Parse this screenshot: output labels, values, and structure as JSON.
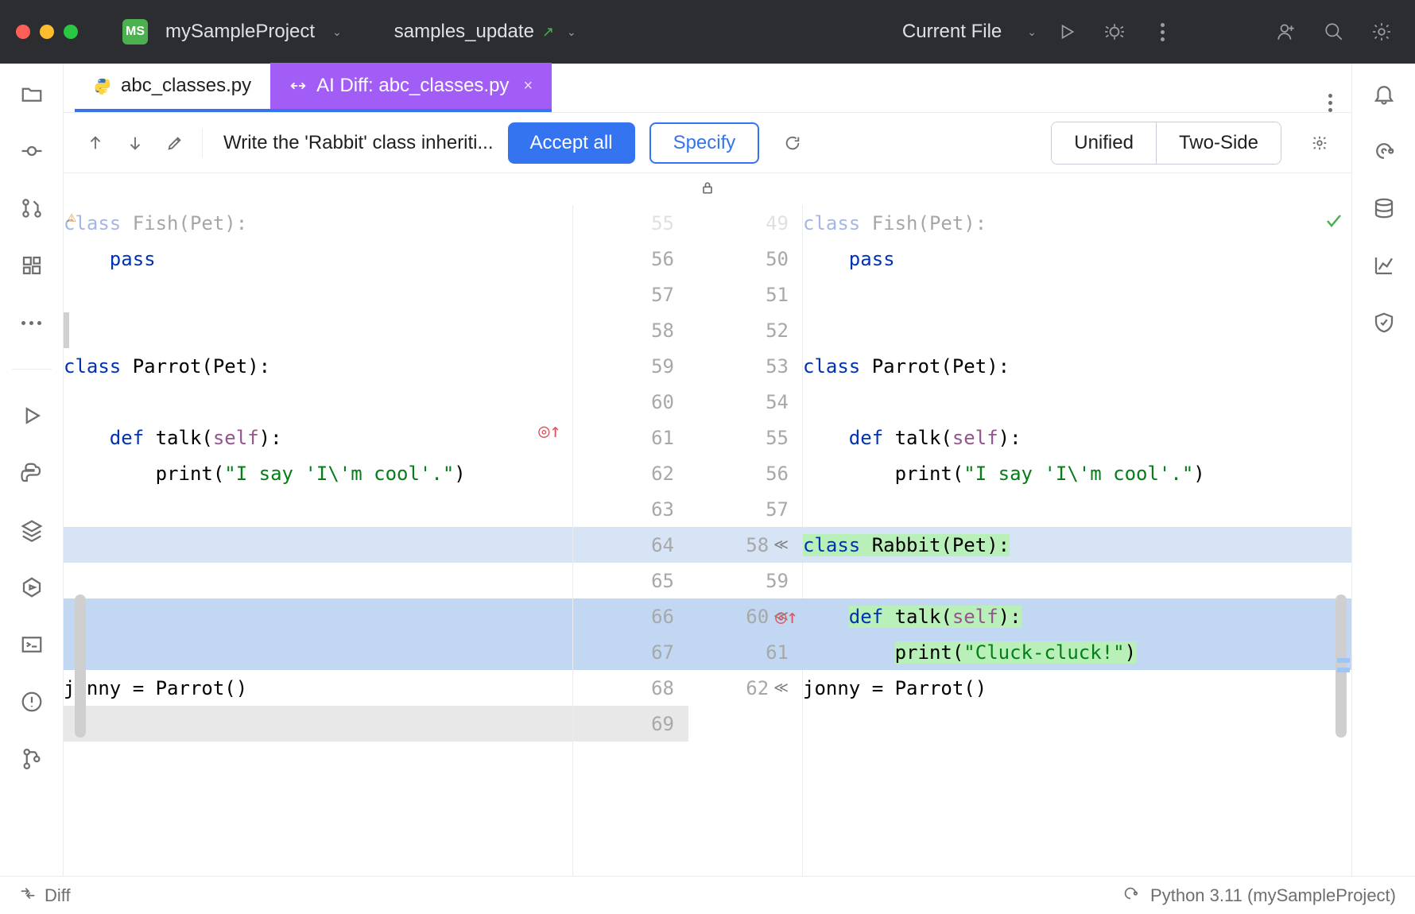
{
  "window": {
    "project_badge": "MS",
    "project_name": "mySampleProject",
    "branch": "samples_update",
    "run_config": "Current File"
  },
  "tabs": {
    "t1": "abc_classes.py",
    "t2": "AI Diff: abc_classes.py"
  },
  "toolbar": {
    "prompt": "Write the 'Rabbit' class inheriti...",
    "accept": "Accept all",
    "specify": "Specify",
    "view_unified": "Unified",
    "view_twoside": "Two-Side"
  },
  "left_lines": {
    "l0": "class Fish(Pet):",
    "l1": "    pass",
    "l2": "",
    "l3": "",
    "l4": "class Parrot(Pet):",
    "l5": "",
    "l6": "    def talk(self):",
    "l7": "        print(\"I say 'I\\'m cool'.\")",
    "l8": "",
    "l9": "",
    "l10": "",
    "l11": "",
    "l12": "",
    "l13": "jonny = Parrot()"
  },
  "right_lines": {
    "r0": "class Fish(Pet):",
    "r1": "    pass",
    "r2": "",
    "r3": "",
    "r4": "class Parrot(Pet):",
    "r5": "",
    "r6": "    def talk(self):",
    "r7": "        print(\"I say 'I\\'m cool'.\")",
    "r8": "",
    "r9": "class Rabbit(Pet):",
    "r10": "",
    "r11": "    def talk(self):",
    "r12": "        print(\"Cluck-cluck!\")",
    "r13": "jonny = Parrot()"
  },
  "gutterL": [
    "55",
    "56",
    "57",
    "58",
    "59",
    "60",
    "61",
    "62",
    "63",
    "64",
    "65",
    "66",
    "67",
    "68",
    "69"
  ],
  "gutterR": [
    "49",
    "50",
    "51",
    "52",
    "53",
    "54",
    "55",
    "56",
    "57",
    "58",
    "59",
    "60",
    "61",
    "62"
  ],
  "status": {
    "left": "Diff",
    "right": "Python 3.11 (mySampleProject)"
  }
}
